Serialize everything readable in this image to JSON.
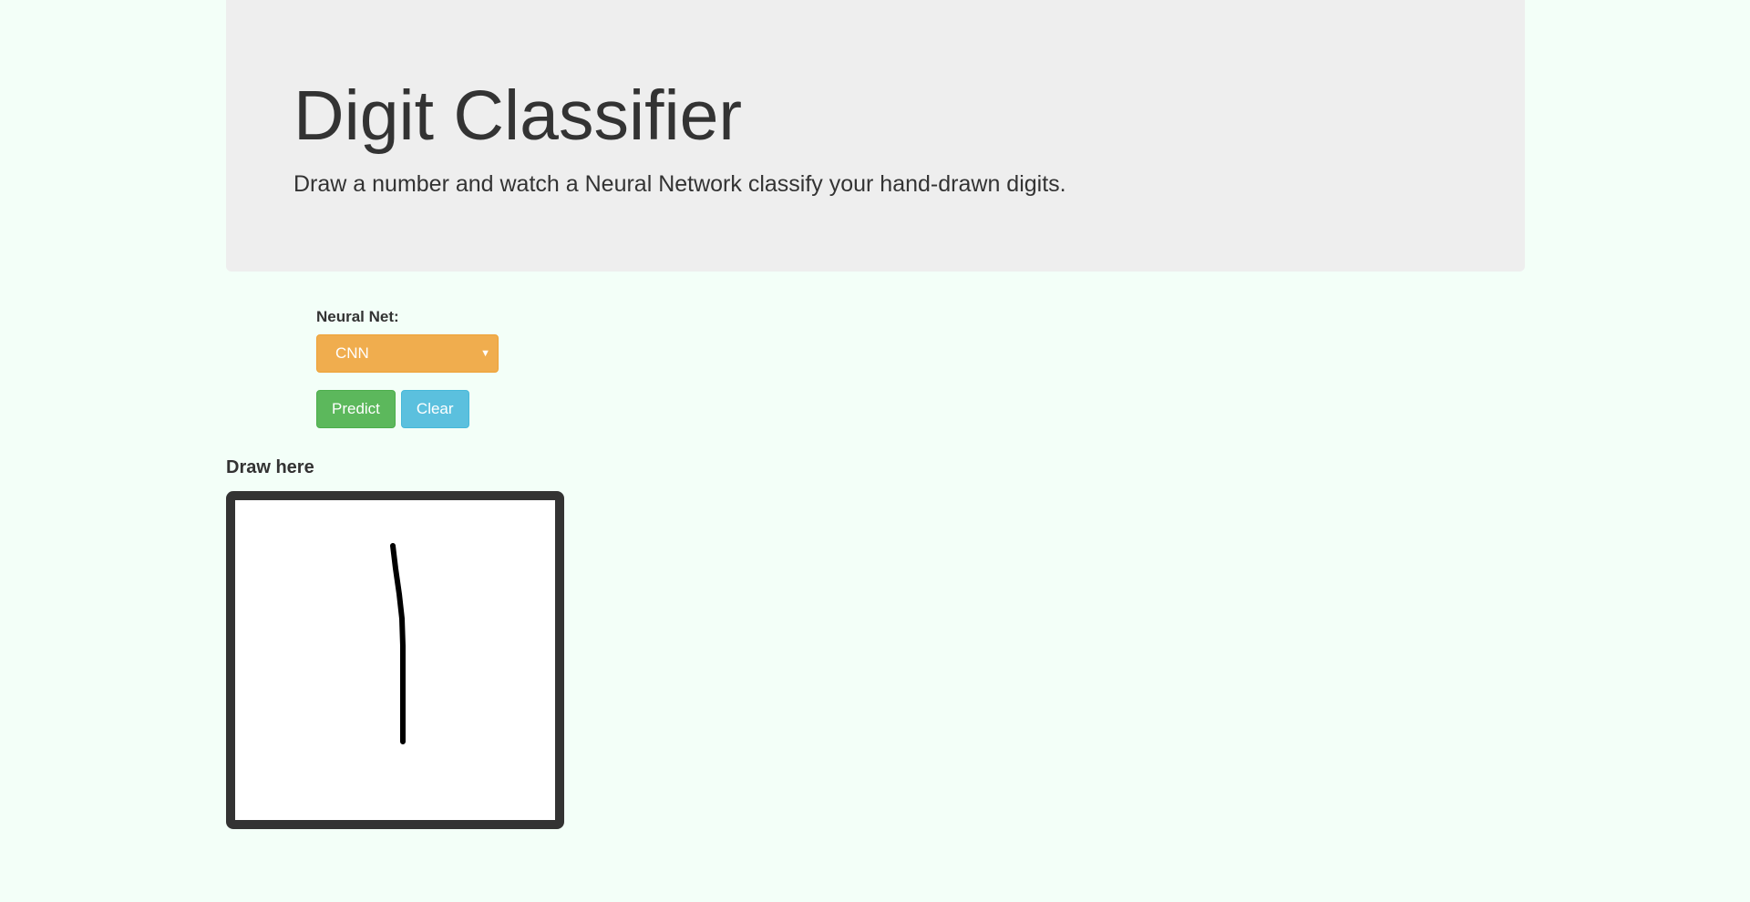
{
  "header": {
    "title": "Digit Classifier",
    "subtitle": "Draw a number and watch a Neural Network classify your hand-drawn digits."
  },
  "controls": {
    "net_label": "Neural Net:",
    "net_select": {
      "selected": "CNN"
    },
    "predict_label": "Predict",
    "clear_label": "Clear"
  },
  "canvas": {
    "label": "Draw here",
    "stroke_color": "#000000"
  },
  "colors": {
    "page_background": "#f3fff8",
    "jumbotron": "#eeeeee",
    "select": "#f0ad4e",
    "predict": "#5cb85c",
    "clear": "#5bc0de",
    "canvas_border": "#333333"
  }
}
